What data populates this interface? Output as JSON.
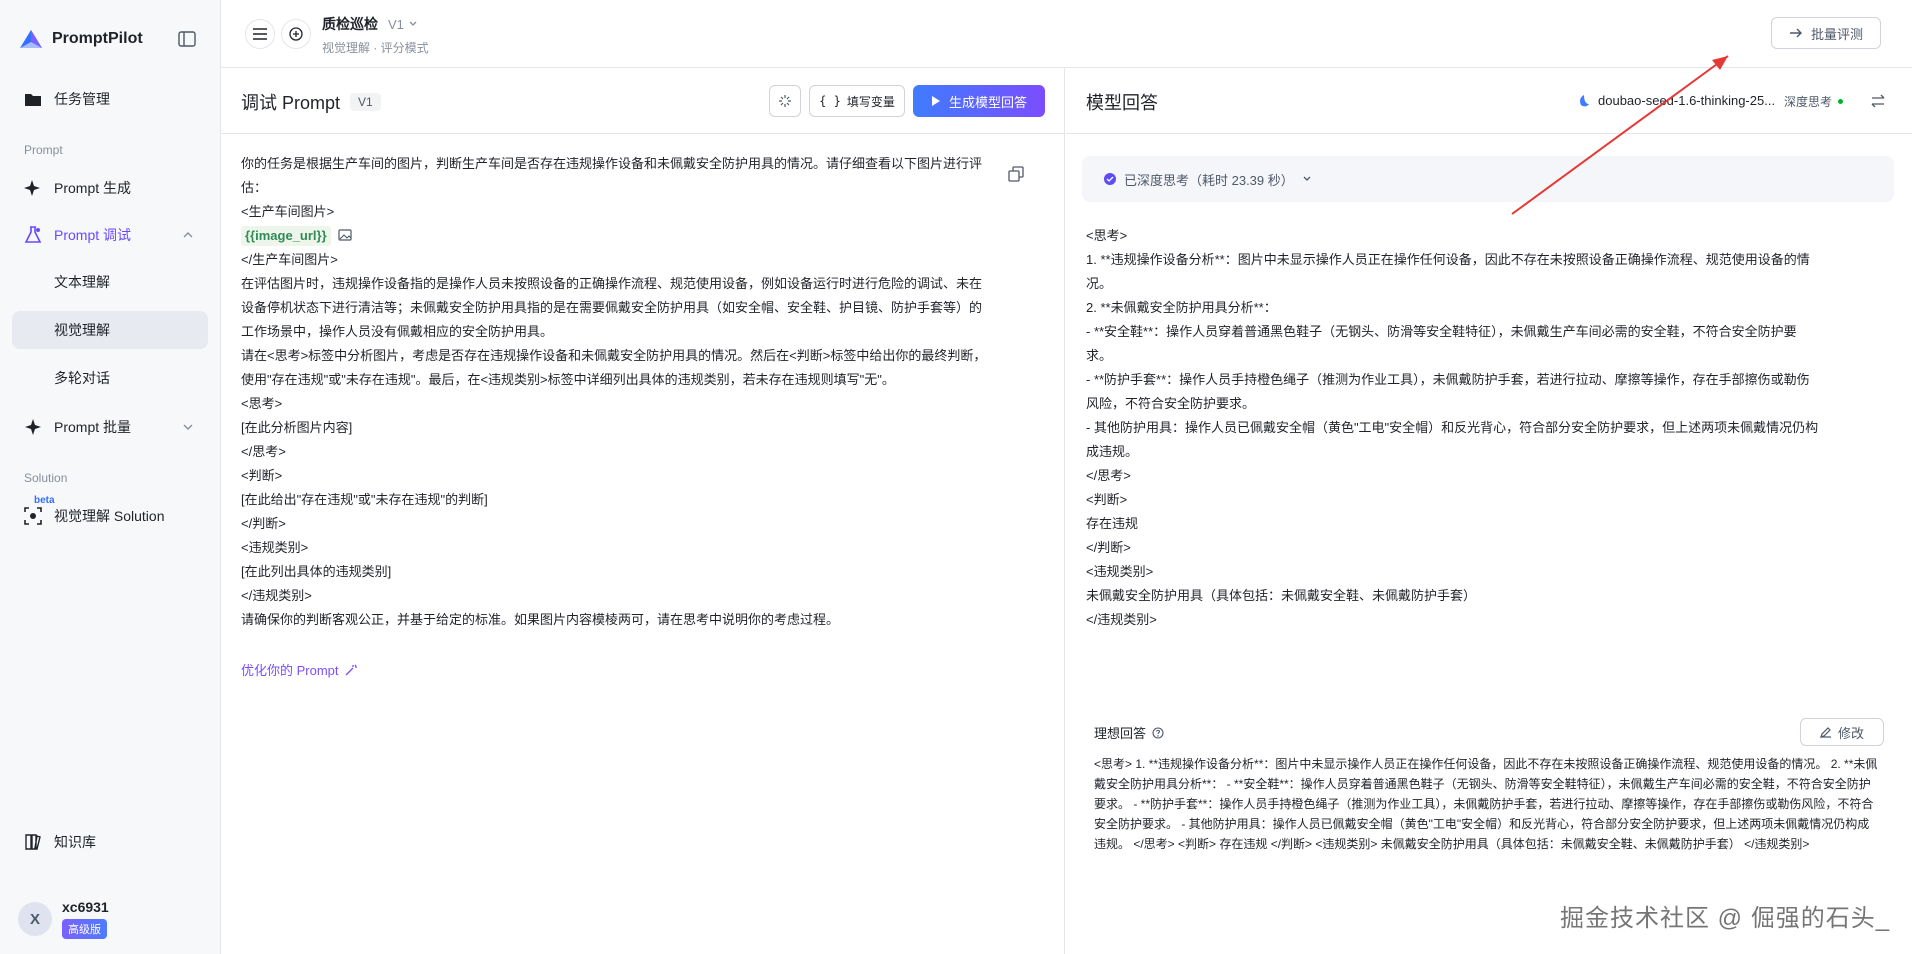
{
  "sidebar": {
    "brand": "PromptPilot",
    "items": {
      "task_mgmt": "任务管理",
      "prompt_gen": "Prompt 生成",
      "prompt_debug": "Prompt 调试",
      "text_understanding": "文本理解",
      "visual_understanding": "视觉理解",
      "multi_turn": "多轮对话",
      "prompt_batch": "Prompt 批量",
      "visual_solution": "视觉理解 Solution",
      "knowledge_base": "知识库"
    },
    "section_prompt": "Prompt",
    "section_solution": "Solution",
    "beta": "beta",
    "user": {
      "initial": "X",
      "name": "xc6931",
      "plan": "高级版"
    }
  },
  "header": {
    "title": "质检巡检",
    "version": "V1",
    "subtitle": "视觉理解 · 评分模式",
    "batch_eval": "批量评测"
  },
  "left": {
    "title": "调试 Prompt",
    "version": "V1",
    "fill_vars": "填写变量",
    "generate": "生成模型回答",
    "prompt_lines": {
      "l1a": "你的任务是根据生产车间的图片，判断生产车间是否存在违规操作设备和未佩戴安全防护用具的情况。请仔细查看以下图片进行评",
      "l1b": "估：",
      "l2": "<生产车间图片>",
      "var": "{{image_url}}",
      "l4": "</生产车间图片>",
      "l5a": "在评估图片时，违规操作设备指的是操作人员未按照设备的正确操作流程、规范使用设备，例如设备运行时进行危险的调试、未在",
      "l5b": "设备停机状态下进行清洁等；未佩戴安全防护用具指的是在需要佩戴安全防护用具（如安全帽、安全鞋、护目镜、防护手套等）的",
      "l5c": "工作场景中，操作人员没有佩戴相应的安全防护用具。",
      "l6a": "请在<思考>标签中分析图片，考虑是否存在违规操作设备和未佩戴安全防护用具的情况。然后在<判断>标签中给出你的最终判断，",
      "l6b": "使用\"存在违规\"或\"未存在违规\"。最后，在<违规类别>标签中详细列出具体的违规类别，若未存在违规则填写\"无\"。",
      "l7": "<思考>",
      "l8": "[在此分析图片内容]",
      "l9": "</思考>",
      "l10": "<判断>",
      "l11": "[在此给出\"存在违规\"或\"未存在违规\"的判断]",
      "l12": "</判断>",
      "l13": "<违规类别>",
      "l14": "[在此列出具体的违规类别]",
      "l15": "</违规类别>",
      "l16": "请确保你的判断客观公正，并基于给定的标准。如果图片内容模棱两可，请在思考中说明你的考虑过程。"
    },
    "optimize": "优化你的 Prompt"
  },
  "right": {
    "title": "模型回答",
    "model": "doubao-seed-1.6-thinking-25...",
    "deep_think": "深度思考",
    "thought_done": "已深度思考（耗时 23.39 秒）",
    "answer_lines": {
      "a1": "<思考>",
      "a2a": "1. **违规操作设备分析**：图片中未显示操作人员正在操作任何设备，因此不存在未按照设备正确操作流程、规范使用设备的情",
      "a2b": "况。",
      "a3": "2. **未佩戴安全防护用具分析**：",
      "a4a": " - **安全鞋**：操作人员穿着普通黑色鞋子（无钢头、防滑等安全鞋特征），未佩戴生产车间必需的安全鞋，不符合安全防护要",
      "a4b": "求。",
      "a5a": " - **防护手套**：操作人员手持橙色绳子（推测为作业工具），未佩戴防护手套，若进行拉动、摩擦等操作，存在手部擦伤或勒伤",
      "a5b": "风险，不符合安全防护要求。",
      "a6a": " - 其他防护用具：操作人员已佩戴安全帽（黄色\"工电\"安全帽）和反光背心，符合部分安全防护要求，但上述两项未佩戴情况仍构",
      "a6b": "成违规。",
      "a7": "</思考>",
      "a8": "<判断>",
      "a9": "存在违规",
      "a10": "</判断>",
      "a11": "<违规类别>",
      "a12": "未佩戴安全防护用具（具体包括：未佩戴安全鞋、未佩戴防护手套）",
      "a13": "</违规类别>"
    },
    "ideal_label": "理想回答",
    "edit": "修改",
    "ideal_text": "<思考> 1. **违规操作设备分析**：图片中未显示操作人员正在操作任何设备，因此不存在未按照设备正确操作流程、规范使用设备的情况。 2. **未佩戴安全防护用具分析**： - **安全鞋**：操作人员穿着普通黑色鞋子（无钢头、防滑等安全鞋特征），未佩戴生产车间必需的安全鞋，不符合安全防护要求。 - **防护手套**：操作人员手持橙色绳子（推测为作业工具），未佩戴防护手套，若进行拉动、摩擦等操作，存在手部擦伤或勒伤风险，不符合安全防护要求。 - 其他防护用具：操作人员已佩戴安全帽（黄色\"工电\"安全帽）和反光背心，符合部分安全防护要求，但上述两项未佩戴情况仍构成违规。 </思考> <判断> 存在违规 </判断> <违规类别> 未佩戴安全防护用具（具体包括：未佩戴安全鞋、未佩戴防护手套） </违规类别>"
  },
  "watermark": "掘金技术社区 @ 倔强的石头_",
  "colors": {
    "accent": "#6b48ff",
    "primary_blue": "#3f7cff",
    "arrow_red": "#e53935"
  }
}
